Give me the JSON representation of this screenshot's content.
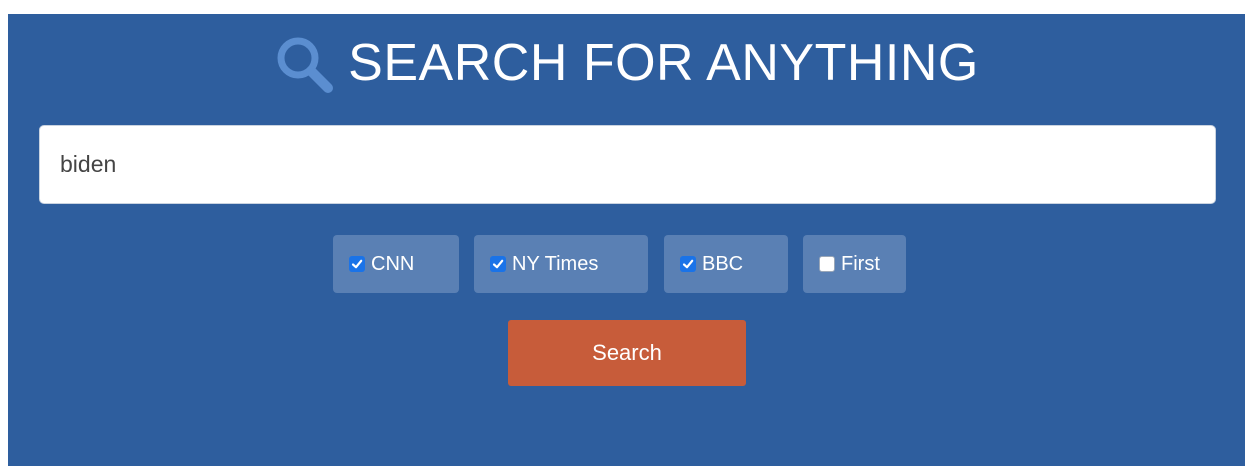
{
  "header": {
    "title": "SEARCH FOR ANYTHING",
    "icon": "search-icon"
  },
  "search": {
    "value": "biden"
  },
  "filters": [
    {
      "label": "CNN",
      "checked": true
    },
    {
      "label": "NY Times",
      "checked": true
    },
    {
      "label": "BBC",
      "checked": true
    },
    {
      "label": "First",
      "checked": false
    }
  ],
  "actions": {
    "search_label": "Search"
  },
  "colors": {
    "panel_background": "#2e5e9e",
    "chip_background": "#5a80b4",
    "button_background": "#c75c3a",
    "title_icon": "#5b8ed0",
    "checkbox_checked": "#1a73e8"
  }
}
